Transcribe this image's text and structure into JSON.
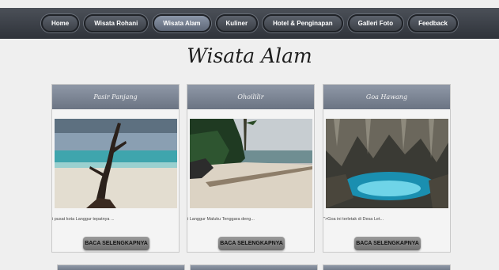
{
  "nav": {
    "items": [
      {
        "label": "Home"
      },
      {
        "label": "Wisata Rohani"
      },
      {
        "label": "Wisata Alam"
      },
      {
        "label": "Kuliner"
      },
      {
        "label": "Hotel & Penginapan"
      },
      {
        "label": "Galleri Foto"
      },
      {
        "label": "Feedback"
      }
    ],
    "active_index": 2
  },
  "page": {
    "title": "Wisata Alam"
  },
  "cards": [
    {
      "title": "Pasir Panjang",
      "excerpt": "i pusat kota Langgur tepatnya ...",
      "button": "BACA SELENGKAPNYA"
    },
    {
      "title": "Ohoililir",
      "excerpt": "i Langgur Maluku Tenggara deng...",
      "button": "BACA SELENGKAPNYA"
    },
    {
      "title": "Goa Hawang",
      "excerpt": "\">Goa ini terletak di Desa Let...",
      "button": "BACA SELENGKAPNYA"
    }
  ],
  "colors": {
    "nav_bg": "#3a3e45",
    "card_header": "#7c8595",
    "button": "#858585",
    "page_bg": "#efefef"
  }
}
